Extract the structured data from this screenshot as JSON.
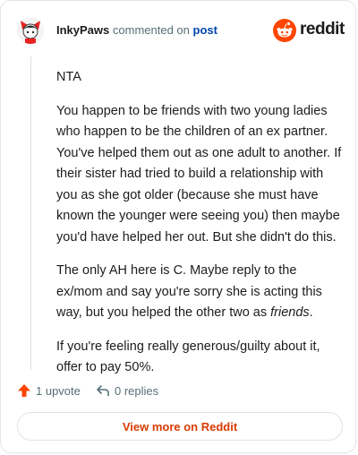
{
  "comment": {
    "author": "InkyPaws",
    "verb": "commented on",
    "target": "post",
    "brand": "reddit",
    "paragraphs": [
      "NTA",
      "You happen to be friends with two young ladies who happen to be the children of an ex partner. You've helped them out as one adult to another. If their sister had tried to build a relationship with you as she got older (because she must have known the younger were seeing you) then maybe you'd have helped her out. But she didn't do this.",
      "The only AH here is C. Maybe reply to the ex/mom and say you're sorry she is acting this way, but you helped the other two as ",
      "If you're feeling really generous/guilty about it, offer to pay 50%."
    ],
    "emphasis": "friends",
    "emphasis_tail": "."
  },
  "footer": {
    "upvotes": "1 upvote",
    "replies": "0 replies"
  },
  "cta": "View more on Reddit",
  "colors": {
    "brand": "#ff4500",
    "upvote": "#ff4500",
    "cta_text": "#d93a00",
    "link": "#0045ac"
  },
  "icons": [
    "avatar",
    "reddit-logo-icon",
    "upvote-arrow-icon",
    "reply-icon"
  ]
}
